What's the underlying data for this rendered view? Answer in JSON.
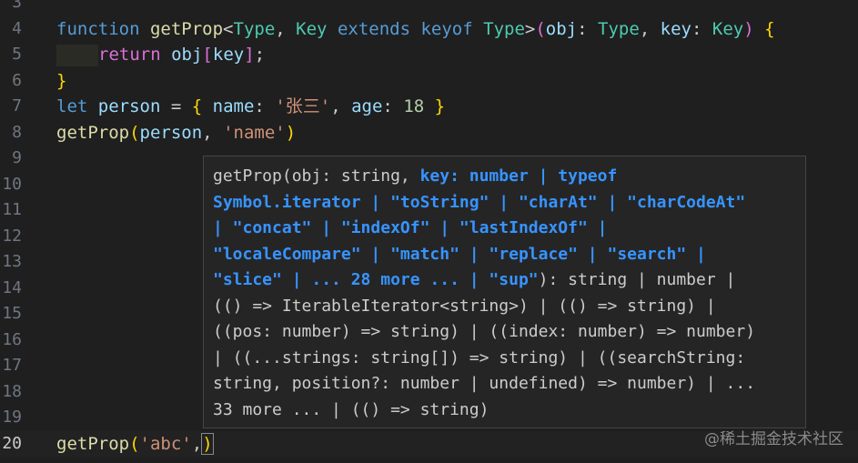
{
  "editor": {
    "lines": [
      {
        "num": "3"
      },
      {
        "num": "4",
        "segments": [
          {
            "t": "function",
            "c": "kw"
          },
          {
            "t": " ",
            "c": "pu"
          },
          {
            "t": "getProp",
            "c": "fn"
          },
          {
            "t": "<",
            "c": "pu"
          },
          {
            "t": "Type",
            "c": "ty"
          },
          {
            "t": ", ",
            "c": "pu"
          },
          {
            "t": "Key",
            "c": "ty"
          },
          {
            "t": " ",
            "c": "pu"
          },
          {
            "t": "extends",
            "c": "kw"
          },
          {
            "t": " ",
            "c": "pu"
          },
          {
            "t": "keyof",
            "c": "kw"
          },
          {
            "t": " ",
            "c": "pu"
          },
          {
            "t": "Type",
            "c": "ty"
          },
          {
            "t": ">",
            "c": "pu"
          },
          {
            "t": "(",
            "c": "br2"
          },
          {
            "t": "obj",
            "c": "id"
          },
          {
            "t": ": ",
            "c": "pu"
          },
          {
            "t": "Type",
            "c": "ty"
          },
          {
            "t": ", ",
            "c": "pu"
          },
          {
            "t": "key",
            "c": "id"
          },
          {
            "t": ": ",
            "c": "pu"
          },
          {
            "t": "Key",
            "c": "ty"
          },
          {
            "t": ")",
            "c": "br2"
          },
          {
            "t": " ",
            "c": "pu"
          },
          {
            "t": "{",
            "c": "br1"
          }
        ]
      },
      {
        "num": "5",
        "indent": true,
        "segments": [
          {
            "t": "return",
            "c": "br2"
          },
          {
            "t": " ",
            "c": "pu"
          },
          {
            "t": "obj",
            "c": "id"
          },
          {
            "t": "[",
            "c": "br2"
          },
          {
            "t": "key",
            "c": "id"
          },
          {
            "t": "]",
            "c": "br2"
          },
          {
            "t": ";",
            "c": "pu"
          }
        ]
      },
      {
        "num": "6",
        "segments": [
          {
            "t": "}",
            "c": "br1"
          }
        ]
      },
      {
        "num": "7",
        "segments": [
          {
            "t": "let",
            "c": "kw"
          },
          {
            "t": " ",
            "c": "pu"
          },
          {
            "t": "person",
            "c": "id"
          },
          {
            "t": " = ",
            "c": "pu"
          },
          {
            "t": "{",
            "c": "br1"
          },
          {
            "t": " ",
            "c": "pu"
          },
          {
            "t": "name",
            "c": "id"
          },
          {
            "t": ": ",
            "c": "pu"
          },
          {
            "t": "'张三'",
            "c": "str"
          },
          {
            "t": ", ",
            "c": "pu"
          },
          {
            "t": "age",
            "c": "id"
          },
          {
            "t": ": ",
            "c": "pu"
          },
          {
            "t": "18",
            "c": "num"
          },
          {
            "t": " ",
            "c": "pu"
          },
          {
            "t": "}",
            "c": "br1"
          }
        ]
      },
      {
        "num": "8",
        "segments": [
          {
            "t": "getProp",
            "c": "fn"
          },
          {
            "t": "(",
            "c": "br1"
          },
          {
            "t": "person",
            "c": "id"
          },
          {
            "t": ", ",
            "c": "pu"
          },
          {
            "t": "'name'",
            "c": "str"
          },
          {
            "t": ")",
            "c": "br1"
          }
        ]
      },
      {
        "num": "9"
      },
      {
        "num": "10"
      },
      {
        "num": "11"
      },
      {
        "num": "12"
      },
      {
        "num": "13"
      },
      {
        "num": "14"
      },
      {
        "num": "15"
      },
      {
        "num": "16"
      },
      {
        "num": "17"
      },
      {
        "num": "18"
      },
      {
        "num": "19"
      },
      {
        "num": "20",
        "active": true,
        "segments": [
          {
            "t": "getProp",
            "c": "fn"
          },
          {
            "t": "(",
            "c": "br1"
          },
          {
            "t": "'abc'",
            "c": "str"
          },
          {
            "t": ",",
            "c": "pu"
          },
          {
            "t": ")",
            "c": "br1"
          }
        ]
      }
    ]
  },
  "hover": {
    "lines": [
      [
        {
          "t": "getProp(obj: string, ",
          "h": false
        },
        {
          "t": "key: number | typeof",
          "h": true
        }
      ],
      [
        {
          "t": "Symbol.iterator | \"toString\" | \"charAt\" | \"charCodeAt\"",
          "h": true
        }
      ],
      [
        {
          "t": "| \"concat\" | \"indexOf\" | \"lastIndexOf\" |",
          "h": true
        }
      ],
      [
        {
          "t": "\"localeCompare\" | \"match\" | \"replace\" | \"search\" |",
          "h": true
        }
      ],
      [
        {
          "t": "\"slice\" | ... 28 more ... | \"sup\"",
          "h": true
        },
        {
          "t": "): string | number |",
          "h": false
        }
      ],
      [
        {
          "t": "(() => IterableIterator<string>) | (() => string) |",
          "h": false
        }
      ],
      [
        {
          "t": "((pos: number) => string) | ((index: number) => number)",
          "h": false
        }
      ],
      [
        {
          "t": "| ((...strings: string[]) => string) | ((searchString:",
          "h": false
        }
      ],
      [
        {
          "t": "string, position?: number | undefined) => number) | ...",
          "h": false
        }
      ],
      [
        {
          "t": "33 more ... | (() => string)",
          "h": false
        }
      ]
    ]
  },
  "watermark": "@稀土掘金技术社区"
}
